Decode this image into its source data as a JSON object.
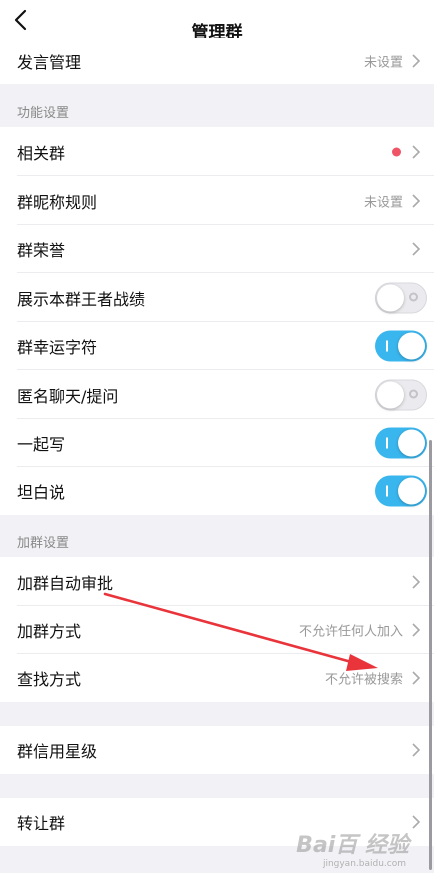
{
  "header": {
    "title": "管理群"
  },
  "rows_top": {
    "speak_label": "发言管理",
    "speak_value": "未设置"
  },
  "sections": {
    "function_settings": "功能设置",
    "join_settings": "加群设置"
  },
  "function_rows": {
    "related_groups": "相关群",
    "nickname_rules": "群昵称规则",
    "nickname_rules_value": "未设置",
    "group_honor": "群荣誉",
    "show_king_glory": "展示本群王者战绩",
    "lucky_character": "群幸运字符",
    "anonymous_chat": "匿名聊天/提问",
    "write_together": "一起写",
    "be_honest": "坦白说"
  },
  "toggles": {
    "show_king_glory": false,
    "lucky_character": true,
    "anonymous_chat": false,
    "write_together": true,
    "be_honest": true
  },
  "join_rows": {
    "auto_approve": "加群自动审批",
    "join_method": "加群方式",
    "join_method_value": "不允许任何人加入",
    "find_method": "查找方式",
    "find_method_value": "不允许被搜索"
  },
  "other_rows": {
    "credit_level": "群信用星级",
    "transfer_group": "转让群"
  },
  "watermark": {
    "text": "Bai百 经验",
    "sub": "jingyan.baidu.com"
  },
  "colors": {
    "toggle_on": "#3ab6ee",
    "red_dot": "#ef5565",
    "annotation_arrow": "#e8343a"
  },
  "icons": {
    "back": "chevron-left-icon",
    "chevron": "chevron-right-icon"
  }
}
